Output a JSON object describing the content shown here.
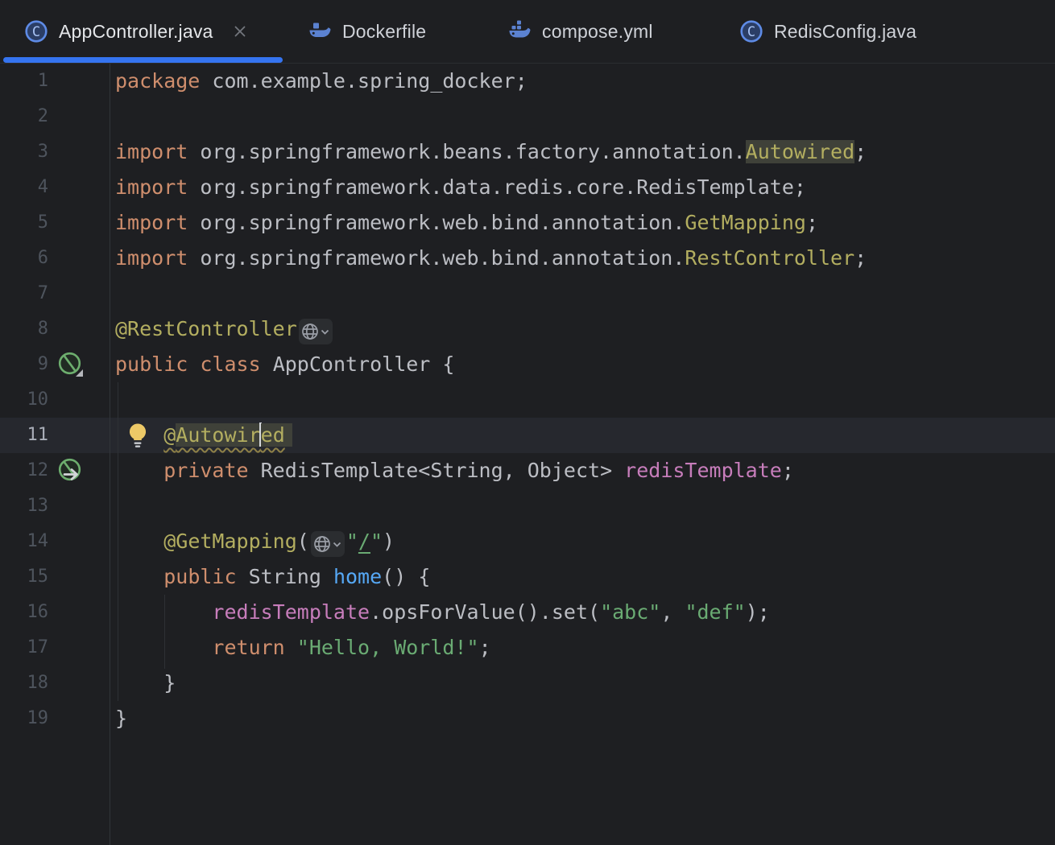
{
  "window": {
    "app": "IntelliJ IDEA editor (dark new UI)"
  },
  "colors": {
    "background": "#1E1F22",
    "accent_blue": "#3574F0",
    "keyword": "#CF8E6D",
    "annotation": "#B3AE60",
    "string": "#6AAB73",
    "field": "#C77DBB",
    "method": "#56A8F5",
    "default_text": "#BCBEC4",
    "caret_line": "#26282E",
    "identifier_highlight": "#3F4139",
    "spring_bean_green": "#6DAE6E",
    "docker_blue": "#5B82D1",
    "bulb_yellow": "#EDC967"
  },
  "tabs": [
    {
      "label": "AppController.java",
      "icon": "java-class-icon",
      "active": true,
      "close_icon": "close-icon"
    },
    {
      "label": "Dockerfile",
      "icon": "docker-icon",
      "active": false
    },
    {
      "label": "compose.yml",
      "icon": "docker-compose-icon",
      "active": false
    },
    {
      "label": "RedisConfig.java",
      "icon": "java-class-icon",
      "active": false
    }
  ],
  "editor": {
    "language": "java",
    "caret": {
      "line": 11,
      "after_text": "@Autowir"
    },
    "lines": [
      {
        "num": "1",
        "tokens": [
          {
            "t": "package",
            "c": "kw"
          },
          {
            "t": " com.example.spring_docker;",
            "c": "def"
          }
        ]
      },
      {
        "num": "2",
        "tokens": []
      },
      {
        "num": "3",
        "tokens": [
          {
            "t": "import",
            "c": "kw"
          },
          {
            "t": " org.springframework.beans.factory.annotation.",
            "c": "def"
          },
          {
            "t": "Autowired",
            "c": "ann hl"
          },
          {
            "t": ";",
            "c": "def"
          }
        ]
      },
      {
        "num": "4",
        "tokens": [
          {
            "t": "import",
            "c": "kw"
          },
          {
            "t": " org.springframework.data.redis.core.RedisTemplate;",
            "c": "def"
          }
        ]
      },
      {
        "num": "5",
        "tokens": [
          {
            "t": "import",
            "c": "kw"
          },
          {
            "t": " org.springframework.web.bind.annotation.",
            "c": "def"
          },
          {
            "t": "GetMapping",
            "c": "ann"
          },
          {
            "t": ";",
            "c": "def"
          }
        ]
      },
      {
        "num": "6",
        "tokens": [
          {
            "t": "import",
            "c": "kw"
          },
          {
            "t": " org.springframework.web.bind.annotation.",
            "c": "def"
          },
          {
            "t": "RestController",
            "c": "ann"
          },
          {
            "t": ";",
            "c": "def"
          }
        ]
      },
      {
        "num": "7",
        "tokens": []
      },
      {
        "num": "8",
        "tokens": [
          {
            "t": "@RestController",
            "c": "ann"
          },
          {
            "inlay": "url-globe"
          }
        ]
      },
      {
        "num": "9",
        "gutterIcon": "spring-bean-dropdown",
        "tokens": [
          {
            "t": "public",
            "c": "kw"
          },
          {
            "t": " ",
            "c": "def"
          },
          {
            "t": "class",
            "c": "kw"
          },
          {
            "t": " AppController {",
            "c": "def"
          }
        ]
      },
      {
        "num": "10",
        "tokens": []
      },
      {
        "num": "11",
        "current": true,
        "bulb": true,
        "tokens": [
          {
            "t": "    ",
            "c": "def"
          },
          {
            "t": "@",
            "c": "ann sq"
          },
          {
            "t": "Autowir",
            "c": "ann sq hl2"
          },
          {
            "caret": true
          },
          {
            "t": "ed",
            "c": "ann sq hl2 last"
          }
        ]
      },
      {
        "num": "12",
        "gutterIcon": "spring-bean-arrow",
        "tokens": [
          {
            "t": "    ",
            "c": "def"
          },
          {
            "t": "private",
            "c": "kw"
          },
          {
            "t": " RedisTemplate<String, Object> ",
            "c": "def"
          },
          {
            "t": "redisTemplate",
            "c": "fld"
          },
          {
            "t": ";",
            "c": "def"
          }
        ]
      },
      {
        "num": "13",
        "tokens": []
      },
      {
        "num": "14",
        "tokens": [
          {
            "t": "    ",
            "c": "def"
          },
          {
            "t": "@GetMapping",
            "c": "ann"
          },
          {
            "t": "(",
            "c": "def"
          },
          {
            "inlay": "url-globe"
          },
          {
            "t": "\"",
            "c": "str"
          },
          {
            "t": "/",
            "c": "str lnk"
          },
          {
            "t": "\"",
            "c": "str"
          },
          {
            "t": ")",
            "c": "def"
          }
        ]
      },
      {
        "num": "15",
        "tokens": [
          {
            "t": "    ",
            "c": "def"
          },
          {
            "t": "public",
            "c": "kw"
          },
          {
            "t": " String ",
            "c": "def"
          },
          {
            "t": "home",
            "c": "mtd"
          },
          {
            "t": "() {",
            "c": "def"
          }
        ]
      },
      {
        "num": "16",
        "tokens": [
          {
            "t": "        ",
            "c": "def"
          },
          {
            "t": "redisTemplate",
            "c": "fld"
          },
          {
            "t": ".opsForValue().set(",
            "c": "def"
          },
          {
            "t": "\"abc\"",
            "c": "str"
          },
          {
            "t": ", ",
            "c": "def"
          },
          {
            "t": "\"def\"",
            "c": "str"
          },
          {
            "t": ");",
            "c": "def"
          }
        ]
      },
      {
        "num": "17",
        "tokens": [
          {
            "t": "        ",
            "c": "def"
          },
          {
            "t": "return",
            "c": "kw"
          },
          {
            "t": " ",
            "c": "def"
          },
          {
            "t": "\"Hello, World!\"",
            "c": "str"
          },
          {
            "t": ";",
            "c": "def"
          }
        ]
      },
      {
        "num": "18",
        "tokens": [
          {
            "t": "    }",
            "c": "def"
          }
        ]
      },
      {
        "num": "19",
        "tokens": [
          {
            "t": "}",
            "c": "def"
          }
        ]
      }
    ]
  }
}
